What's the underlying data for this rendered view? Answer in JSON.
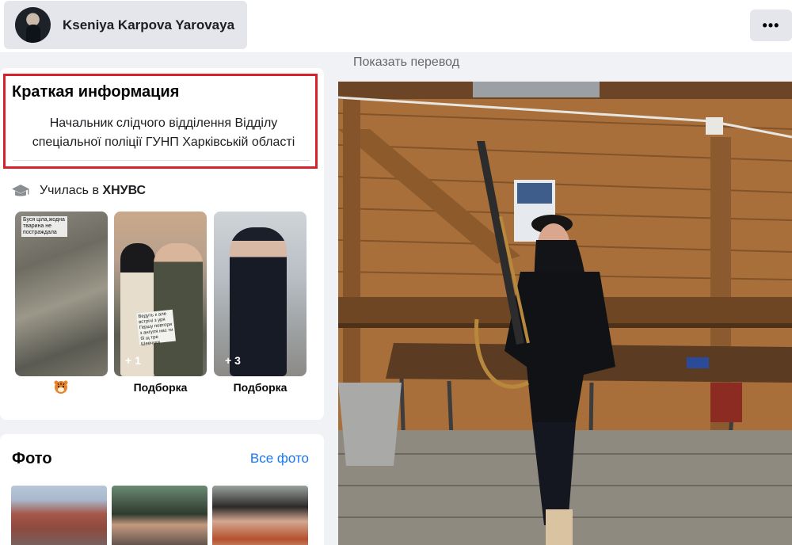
{
  "header": {
    "profile_name": "Kseniya Karpova Yarovaya",
    "more_label": "•••"
  },
  "intro": {
    "title": "Краткая информация",
    "bio": "Начальник слідчого відділення Відділу спеціальної поліції ГУНП Харківській області",
    "education_prefix": "Училась в ",
    "education_school": "ХНУВС",
    "featured": [
      {
        "overlay_text": "Буся ціла,жодна тварина не постраждала",
        "count": "",
        "label": ""
      },
      {
        "overlay_text": "Ведуть к але встрічі з уря Гершу повтори з ангуля нас ти бі щ тре Шевчуки",
        "count": "+ 1",
        "label": "Подборка"
      },
      {
        "overlay_text": "",
        "count": "+ 3",
        "label": "Подборка"
      }
    ]
  },
  "photos": {
    "title": "Фото",
    "all_photos_link": "Все фото"
  },
  "post": {
    "translate_label": "Показать перевод"
  },
  "colors": {
    "highlight_border": "#d6222b",
    "link": "#1877f2",
    "page_bg": "#f0f2f5"
  }
}
